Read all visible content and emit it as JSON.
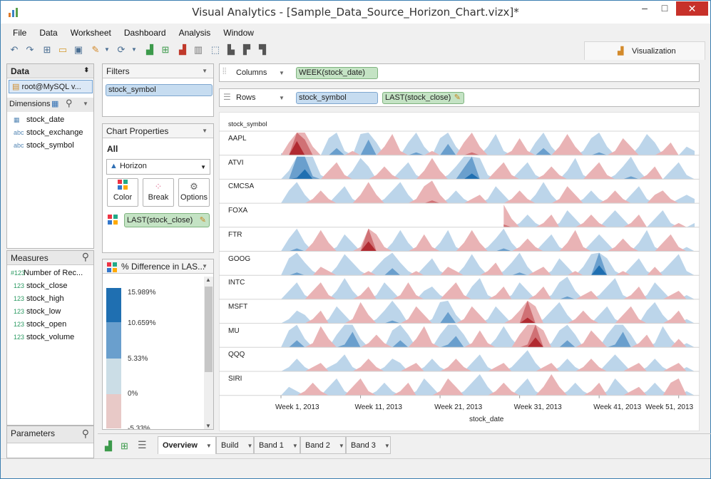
{
  "window": {
    "title": "Visual Analytics - [Sample_Data_Source_Horizon_Chart.vizx]*",
    "minimize": "–",
    "maximize": "□",
    "close": "✕"
  },
  "menu": [
    "File",
    "Data",
    "Worksheet",
    "Dashboard",
    "Analysis",
    "Window"
  ],
  "toolbar_icons": [
    "undo-icon",
    "redo-icon",
    "new-icon",
    "open-icon",
    "save-icon",
    "auto-chart-icon",
    "refresh-icon",
    "add-chart-icon",
    "add-grid-icon",
    "delete-chart-icon",
    "chart-type-icon",
    "select-icon",
    "sort-asc-icon",
    "sort-desc-icon",
    "align-icon"
  ],
  "visualization_tab": "Visualization",
  "data_panel": {
    "header": "Data",
    "source": "root@MySQL v...",
    "dimensions_label": "Dimensions",
    "dimensions": [
      {
        "type": "date",
        "label": "stock_date"
      },
      {
        "type": "abc",
        "label": "stock_exchange"
      },
      {
        "type": "abc",
        "label": "stock_symbol"
      }
    ],
    "measures_label": "Measures",
    "measures": [
      {
        "type": "#123",
        "label": "Number of Rec..."
      },
      {
        "type": "123",
        "label": "stock_close"
      },
      {
        "type": "123",
        "label": "stock_high"
      },
      {
        "type": "123",
        "label": "stock_low"
      },
      {
        "type": "123",
        "label": "stock_open"
      },
      {
        "type": "123",
        "label": "stock_volume"
      }
    ],
    "parameters_label": "Parameters"
  },
  "filters": {
    "label": "Filters",
    "items": [
      "stock_symbol"
    ]
  },
  "chart_properties": {
    "label": "Chart Properties",
    "all": "All",
    "chart_type": "Horizon",
    "buttons": [
      "Color",
      "Break",
      "Options"
    ],
    "color_field": "LAST(stock_close)"
  },
  "legend": {
    "title": "% Difference in LAS...",
    "labels": [
      "15.989%",
      "10.659%",
      "5.33%",
      "0%",
      "-5.33%"
    ]
  },
  "shelves": {
    "columns_label": "Columns",
    "columns_pill": "WEEK(stock_date)",
    "rows_label": "Rows",
    "rows_pills": [
      "stock_symbol",
      "LAST(stock_close)"
    ]
  },
  "tabs": [
    "Overview",
    "Build",
    "Band 1",
    "Band 2",
    "Band 3"
  ],
  "colors": {
    "blue_light": "#bcd5ea",
    "blue_mid": "#6a9fcd",
    "blue_dark": "#1f6fb1",
    "red_light": "#e9b3b5",
    "red_mid": "#d07175",
    "red_dark": "#b12a31"
  },
  "chart_data": {
    "type": "horizon",
    "row_header": "stock_symbol",
    "xlabel": "stock_date",
    "ylabel": "",
    "x_ticks": [
      "Week 1, 2013",
      "Week 11, 2013",
      "Week 21, 2013",
      "Week 31, 2013",
      "Week 41, 2013",
      "Week 51, 2013"
    ],
    "x_range": [
      1,
      53
    ],
    "categories": [
      "AAPL",
      "ATVI",
      "CMCSA",
      "FOXA",
      "FTR",
      "GOOG",
      "INTC",
      "MSFT",
      "MU",
      "QQQ",
      "SIRI"
    ],
    "band_size_percent": 5.33,
    "series": [
      {
        "name": "AAPL",
        "values": [
          0.5,
          -3,
          -14,
          -9,
          -2,
          0,
          4,
          7,
          1,
          -1,
          5,
          9,
          3,
          -2,
          -5,
          -1,
          3,
          6,
          2,
          -1,
          4,
          8,
          2,
          -3,
          -6,
          -2,
          2,
          5,
          1,
          -1,
          -4,
          -1,
          3,
          7,
          2,
          -2,
          -5,
          -2,
          1,
          4,
          6,
          2,
          -1,
          -4,
          -2,
          2,
          5,
          3,
          -1,
          -3,
          0,
          2,
          1
        ]
      },
      {
        "name": "ATVI",
        "values": [
          0,
          2,
          11,
          13,
          6,
          1,
          -2,
          -4,
          -1,
          2,
          5,
          3,
          -1,
          -3,
          -1,
          2,
          4,
          1,
          -2,
          -5,
          -2,
          1,
          3,
          8,
          12,
          5,
          1,
          -2,
          -4,
          -1,
          2,
          4,
          1,
          -1,
          -3,
          -1,
          2,
          5,
          1,
          -2,
          -4,
          -1,
          1,
          3,
          6,
          2,
          -1,
          -3,
          0,
          2,
          4,
          1,
          0
        ]
      },
      {
        "name": "CMCSA",
        "values": [
          0,
          3,
          5,
          2,
          -1,
          -3,
          -1,
          2,
          4,
          1,
          -2,
          -5,
          -2,
          1,
          3,
          5,
          2,
          -1,
          -4,
          -6,
          -2,
          1,
          3,
          1,
          -1,
          -2,
          1,
          4,
          2,
          -1,
          -3,
          -1,
          2,
          5,
          2,
          -1,
          -4,
          -2,
          1,
          3,
          1,
          -1,
          -3,
          -1,
          2,
          4,
          1,
          -2,
          -3,
          -1,
          1,
          2,
          1
        ]
      },
      {
        "name": "FOXA",
        "values": [
          null,
          null,
          null,
          null,
          null,
          null,
          null,
          null,
          null,
          null,
          null,
          null,
          null,
          null,
          null,
          null,
          null,
          null,
          null,
          null,
          null,
          null,
          null,
          null,
          null,
          null,
          null,
          null,
          -6,
          -2,
          1,
          3,
          1,
          -1,
          -3,
          1,
          4,
          2,
          -1,
          -3,
          -1,
          2,
          4,
          2,
          -1,
          -3,
          0,
          2,
          4,
          1,
          -1,
          0,
          1
        ]
      },
      {
        "name": "FTR",
        "values": [
          0,
          3,
          6,
          2,
          -2,
          -5,
          -2,
          1,
          4,
          2,
          -1,
          -13,
          -4,
          -1,
          2,
          5,
          2,
          -1,
          -4,
          -1,
          2,
          5,
          1,
          -2,
          -5,
          -2,
          1,
          3,
          6,
          2,
          -1,
          -3,
          -1,
          2,
          4,
          1,
          -2,
          -5,
          -1,
          2,
          4,
          2,
          -1,
          -3,
          -1,
          2,
          5,
          1,
          -2,
          -4,
          -1,
          1,
          0
        ]
      },
      {
        "name": "GOOG",
        "values": [
          0,
          4,
          6,
          3,
          1,
          -2,
          -1,
          2,
          5,
          3,
          1,
          -1,
          2,
          4,
          7,
          3,
          1,
          -1,
          2,
          4,
          1,
          -2,
          -1,
          2,
          5,
          2,
          -1,
          -3,
          1,
          3,
          6,
          2,
          -1,
          -2,
          1,
          4,
          2,
          -1,
          2,
          5,
          13,
          4,
          1,
          -1,
          2,
          4,
          1,
          -2,
          1,
          3,
          5,
          1,
          0
        ]
      },
      {
        "name": "INTC",
        "values": [
          0,
          2,
          4,
          1,
          -2,
          -4,
          -1,
          2,
          5,
          2,
          -1,
          -3,
          1,
          4,
          2,
          -1,
          -4,
          -1,
          2,
          3,
          1,
          -2,
          -4,
          -1,
          3,
          5,
          1,
          -1,
          -3,
          1,
          4,
          2,
          -1,
          -3,
          1,
          4,
          6,
          2,
          -1,
          -2,
          1,
          3,
          5,
          1,
          -1,
          -3,
          1,
          4,
          2,
          -1,
          -2,
          1,
          0
        ]
      },
      {
        "name": "MSFT",
        "values": [
          0,
          1,
          3,
          2,
          -1,
          -3,
          1,
          4,
          2,
          -1,
          -5,
          -2,
          1,
          3,
          6,
          3,
          -1,
          -4,
          -2,
          1,
          5,
          8,
          2,
          -1,
          -4,
          -2,
          1,
          4,
          2,
          -1,
          -3,
          -12,
          -4,
          1,
          3,
          5,
          2,
          -1,
          -3,
          -1,
          2,
          4,
          1,
          -2,
          -4,
          -1,
          3,
          5,
          2,
          -1,
          -3,
          1,
          0
        ]
      },
      {
        "name": "MU",
        "values": [
          0,
          4,
          7,
          2,
          -1,
          -5,
          -2,
          3,
          6,
          9,
          2,
          -1,
          -3,
          -1,
          4,
          7,
          3,
          -2,
          -5,
          -1,
          3,
          6,
          8,
          3,
          -1,
          -4,
          -1,
          2,
          5,
          2,
          -3,
          -6,
          -13,
          -4,
          1,
          4,
          7,
          3,
          -1,
          -4,
          -2,
          3,
          6,
          9,
          3,
          -1,
          -3,
          1,
          5,
          2,
          -2,
          1,
          0
        ]
      },
      {
        "name": "QQQ",
        "values": [
          0,
          1,
          3,
          1,
          -1,
          -2,
          1,
          2,
          4,
          1,
          -1,
          -3,
          -1,
          1,
          3,
          2,
          -1,
          -2,
          1,
          3,
          1,
          -1,
          -3,
          -1,
          2,
          4,
          1,
          -1,
          -2,
          1,
          3,
          5,
          2,
          -1,
          -2,
          1,
          3,
          1,
          -1,
          -3,
          -1,
          2,
          4,
          2,
          -1,
          -2,
          1,
          3,
          1,
          -1,
          -2,
          1,
          0
        ]
      },
      {
        "name": "SIRI",
        "values": [
          0,
          2,
          1,
          -1,
          -3,
          -1,
          2,
          4,
          1,
          -2,
          -4,
          -1,
          1,
          3,
          1,
          -1,
          -3,
          1,
          4,
          2,
          -1,
          -4,
          -2,
          1,
          3,
          5,
          2,
          -1,
          -3,
          -1,
          2,
          4,
          1,
          -2,
          -5,
          -2,
          1,
          3,
          1,
          -1,
          -3,
          1,
          4,
          2,
          -1,
          -2,
          1,
          3,
          1,
          -3,
          -4,
          1,
          0
        ]
      }
    ]
  }
}
